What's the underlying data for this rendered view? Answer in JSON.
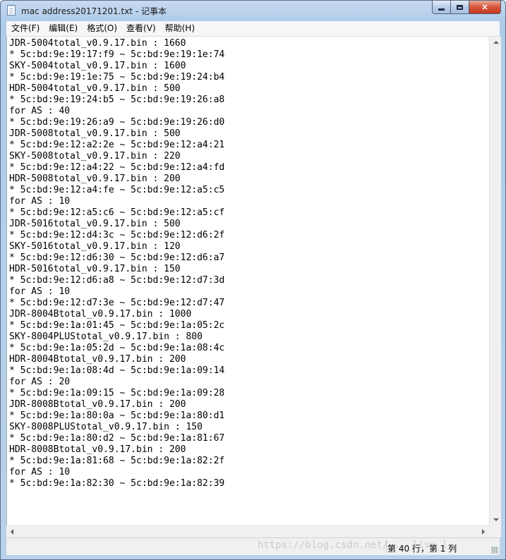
{
  "window": {
    "title": "mac address20171201.txt - 记事本",
    "captions": {
      "minimize": "minimize-button",
      "maximize": "maximize-button",
      "close": "×"
    }
  },
  "menu": [
    {
      "label": "文件(F)"
    },
    {
      "label": "编辑(E)"
    },
    {
      "label": "格式(O)"
    },
    {
      "label": "查看(V)"
    },
    {
      "label": "帮助(H)"
    }
  ],
  "editor": {
    "lines": [
      "JDR-5004total_v0.9.17.bin : 1660",
      "* 5c:bd:9e:19:17:f9 ~ 5c:bd:9e:19:1e:74",
      "SKY-5004total_v0.9.17.bin : 1600",
      "* 5c:bd:9e:19:1e:75 ~ 5c:bd:9e:19:24:b4",
      "HDR-5004total_v0.9.17.bin : 500",
      "* 5c:bd:9e:19:24:b5 ~ 5c:bd:9e:19:26:a8",
      "for AS : 40",
      "* 5c:bd:9e:19:26:a9 ~ 5c:bd:9e:19:26:d0",
      "JDR-5008total_v0.9.17.bin : 500",
      "* 5c:bd:9e:12:a2:2e ~ 5c:bd:9e:12:a4:21",
      "SKY-5008total_v0.9.17.bin : 220",
      "* 5c:bd:9e:12:a4:22 ~ 5c:bd:9e:12:a4:fd",
      "HDR-5008total_v0.9.17.bin : 200",
      "* 5c:bd:9e:12:a4:fe ~ 5c:bd:9e:12:a5:c5",
      "for AS : 10",
      "* 5c:bd:9e:12:a5:c6 ~ 5c:bd:9e:12:a5:cf",
      "JDR-5016total_v0.9.17.bin : 500",
      "* 5c:bd:9e:12:d4:3c ~ 5c:bd:9e:12:d6:2f",
      "SKY-5016total_v0.9.17.bin : 120",
      "* 5c:bd:9e:12:d6:30 ~ 5c:bd:9e:12:d6:a7",
      "HDR-5016total_v0.9.17.bin : 150",
      "* 5c:bd:9e:12:d6:a8 ~ 5c:bd:9e:12:d7:3d",
      "for AS : 10",
      "* 5c:bd:9e:12:d7:3e ~ 5c:bd:9e:12:d7:47",
      "JDR-8004Btotal_v0.9.17.bin : 1000",
      "* 5c:bd:9e:1a:01:45 ~ 5c:bd:9e:1a:05:2c",
      "SKY-8004PLUStotal_v0.9.17.bin : 800",
      "* 5c:bd:9e:1a:05:2d ~ 5c:bd:9e:1a:08:4c",
      "HDR-8004Btotal_v0.9.17.bin : 200",
      "* 5c:bd:9e:1a:08:4d ~ 5c:bd:9e:1a:09:14",
      "for AS : 20",
      "* 5c:bd:9e:1a:09:15 ~ 5c:bd:9e:1a:09:28",
      "JDR-8008Btotal_v0.9.17.bin : 200",
      "* 5c:bd:9e:1a:80:0a ~ 5c:bd:9e:1a:80:d1",
      "SKY-8008PLUStotal_v0.9.17.bin : 150",
      "* 5c:bd:9e:1a:80:d2 ~ 5c:bd:9e:1a:81:67",
      "HDR-8008Btotal_v0.9.17.bin : 200",
      "* 5c:bd:9e:1a:81:68 ~ 5c:bd:9e:1a:82:2f",
      "for AS : 10",
      "* 5c:bd:9e:1a:82:30 ~ 5c:bd:9e:1a:82:39"
    ]
  },
  "status": {
    "position": "第 40 行，第 1 列"
  },
  "watermark": "https://blog.csdn.net/..._live_l"
}
